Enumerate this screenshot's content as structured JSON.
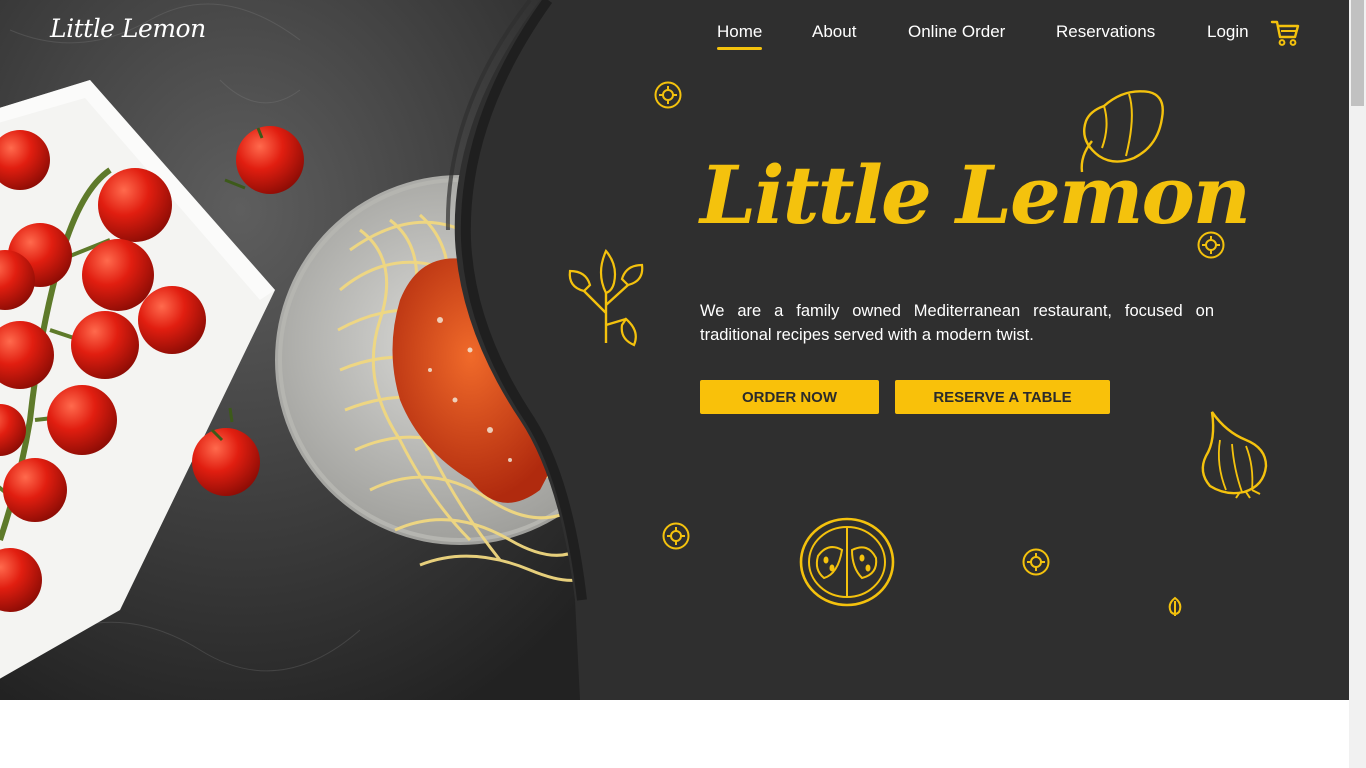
{
  "brand": {
    "logo_text": "Little Lemon"
  },
  "nav": {
    "items": [
      {
        "label": "Home",
        "active": true
      },
      {
        "label": "About",
        "active": false
      },
      {
        "label": "Online Order",
        "active": false
      },
      {
        "label": "Reservations",
        "active": false
      },
      {
        "label": "Login",
        "active": false
      }
    ],
    "cart_icon": "shopping-cart-icon"
  },
  "hero": {
    "title": "Little Lemon",
    "description": "We are a family owned Mediterranean restaurant, focused on traditional recipes served with a modern twist.",
    "order_button": "ORDER NOW",
    "reserve_button": "RESERVE A TABLE",
    "image": "spaghetti-and-cherry-tomatoes-photo",
    "doodles": [
      "lemon-slice-icon",
      "bell-pepper-icon",
      "parsley-icon",
      "garlic-icon",
      "tomato-icon",
      "seed-icon"
    ]
  },
  "colors": {
    "background": "#2f2f2f",
    "accent": "#f4c20d",
    "text": "#ffffff",
    "button_text": "#2b2b2b"
  }
}
